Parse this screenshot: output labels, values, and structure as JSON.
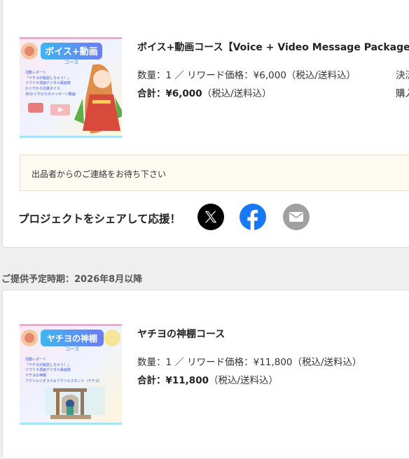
{
  "reward1": {
    "thumbnail_title": "ボイス+動画",
    "thumbnail_subtitle": "コース",
    "thumbnail_items": [
      "活動レポート",
      "「ヤチヨが解説しちゃう！」",
      "リワミキ漫画デジタル版画像",
      "かぐやから応援ボイス",
      "3Dかぐやからのメッセージ動画"
    ],
    "title": "ボイス+動画コース【Voice + Video Message Package】",
    "quantity_line": "数量：1 ／ リワード価格：¥6,000（税込/送料込）",
    "total_label": "合計：¥6,000",
    "total_note": "（税込/送料込）",
    "side_top": "決済",
    "side_bottom": "購入",
    "notice": "出品者からのご連絡をお待ち下さい"
  },
  "share": {
    "label": "プロジェクトをシェアして応援！",
    "icons": [
      "x-logo-icon",
      "facebook-icon",
      "mail-icon"
    ]
  },
  "delivery_period": "ご提供予定時期：2026年8月以降",
  "reward2": {
    "thumbnail_title": "ヤチヨの神棚",
    "thumbnail_subtitle": "コース",
    "thumbnail_items": [
      "活動レポート",
      "「ヤチヨが解説しちゃう！」",
      "リワミキ漫画デジタル版画像",
      "ヤチヨの神棚",
      "アクリルジオラマ＆アクリルスタンド（ヤチヨ）"
    ],
    "title": "ヤチヨの神棚コース",
    "quantity_line": "数量：1 ／ リワード価格：¥11,800（税込/送料込）",
    "total_label": "合計：¥11,800",
    "total_note": "（税込/送料込）"
  },
  "colors": {
    "page_bg": "#efefef",
    "card_bg": "#ffffff",
    "notice_bg": "#fdfaf1",
    "x_brand": "#000000",
    "facebook_brand": "#1877f2",
    "mail_gray": "#a0a0a0"
  }
}
